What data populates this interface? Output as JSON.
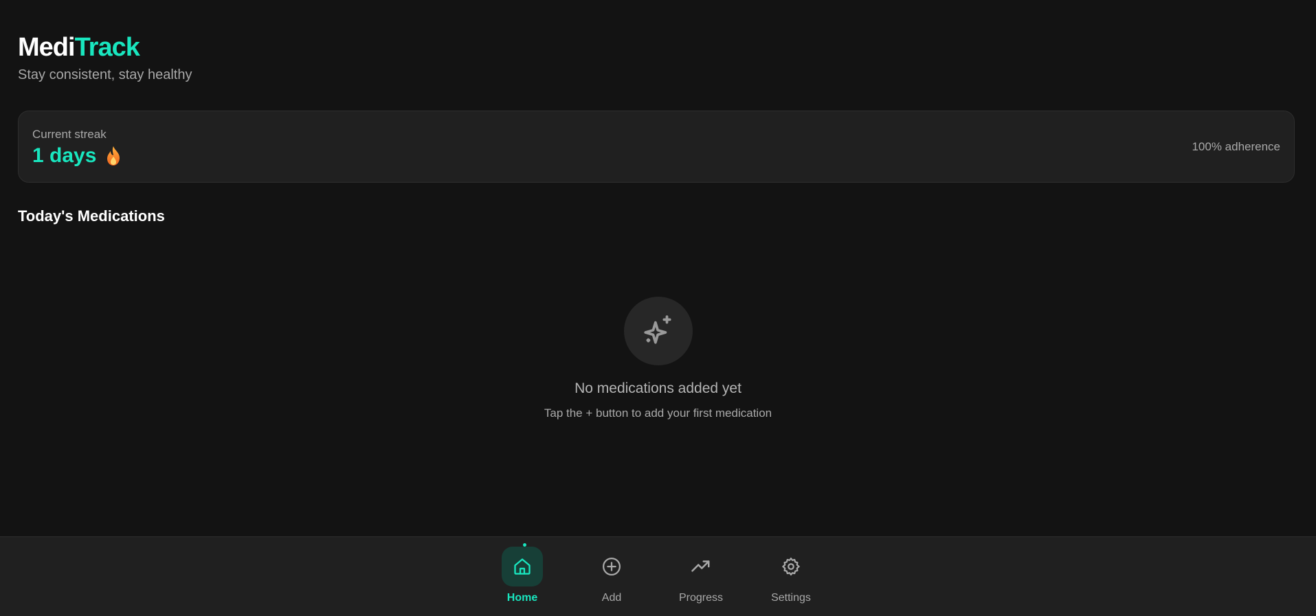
{
  "app": {
    "brand_part_a": "Medi",
    "brand_part_b": "Track",
    "tagline": "Stay consistent, stay healthy"
  },
  "streak": {
    "label": "Current streak",
    "value": "1 days",
    "adherence": "100% adherence"
  },
  "section": {
    "title": "Today's Medications"
  },
  "empty_state": {
    "icon": "sparkles-icon",
    "title": "No medications added yet",
    "subtitle": "Tap the + button to add your first medication"
  },
  "nav": {
    "items": [
      {
        "label": "Home",
        "icon": "home-icon",
        "active": true
      },
      {
        "label": "Add",
        "icon": "plus-circle-icon",
        "active": false
      },
      {
        "label": "Progress",
        "icon": "trending-up-icon",
        "active": false
      },
      {
        "label": "Settings",
        "icon": "gear-icon",
        "active": false
      }
    ]
  },
  "colors": {
    "accent": "#19e6bf",
    "background": "#131313",
    "card": "#202020",
    "muted_text": "#a9a9a9"
  }
}
